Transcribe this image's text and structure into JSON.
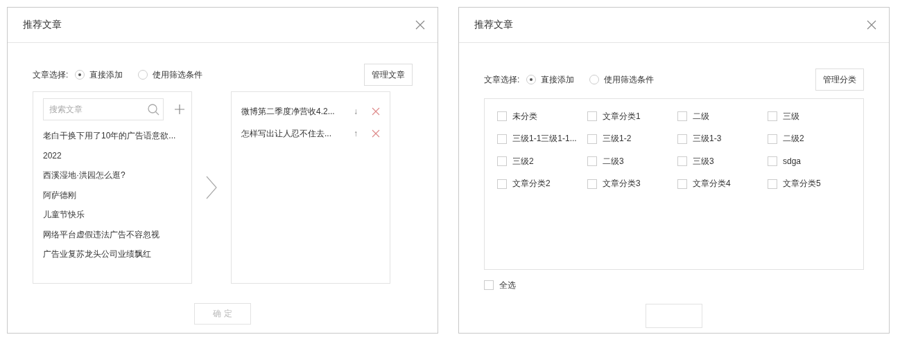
{
  "dialogs": [
    {
      "kind": "transfer",
      "title": "推荐文章",
      "mode_label": "文章选择:",
      "modes": [
        {
          "label": "直接添加",
          "selected": true
        },
        {
          "label": "使用筛选条件",
          "selected": false
        }
      ],
      "manage_button": "管理文章",
      "search": {
        "placeholder": "搜索文章"
      },
      "articles": [
        "老白干换下用了10年的广告语意欲...",
        "2022",
        "西溪湿地·洪园怎么逛?",
        "阿萨德刚",
        "儿童节快乐",
        "网络平台虚假违法广告不容忽视",
        "广告业复苏龙头公司业绩飘红"
      ],
      "selected_articles": [
        {
          "title": "微博第二季度净营收4.2...",
          "move": "↓"
        },
        {
          "title": "怎样写出让人忍不住去...",
          "move": "↑"
        }
      ],
      "confirm": {
        "label": "确 定",
        "disabled": true
      }
    },
    {
      "kind": "categories",
      "title": "推荐文章",
      "mode_label": "文章选择:",
      "modes": [
        {
          "label": "直接添加",
          "selected": true
        },
        {
          "label": "使用筛选条件",
          "selected": false
        }
      ],
      "manage_button": "管理分类",
      "categories": [
        {
          "label": "未分类",
          "checked": false
        },
        {
          "label": "文章分类1",
          "checked": false
        },
        {
          "label": "二级",
          "checked": false
        },
        {
          "label": "三级",
          "checked": false
        },
        {
          "label": "三级1-1三级1-1...",
          "checked": false
        },
        {
          "label": "三级1-2",
          "checked": false
        },
        {
          "label": "三级1-3",
          "checked": false
        },
        {
          "label": "二级2",
          "checked": false
        },
        {
          "label": "三级2",
          "checked": false
        },
        {
          "label": "二级3",
          "checked": false
        },
        {
          "label": "三级3",
          "checked": false
        },
        {
          "label": "sdga",
          "checked": false
        },
        {
          "label": "文章分类2",
          "checked": false
        },
        {
          "label": "文章分类3",
          "checked": false
        },
        {
          "label": "文章分类4",
          "checked": false
        },
        {
          "label": "文章分类5",
          "checked": false
        }
      ],
      "select_all": {
        "label": "全选",
        "checked": false
      },
      "confirm": {
        "disabled": true
      }
    }
  ]
}
